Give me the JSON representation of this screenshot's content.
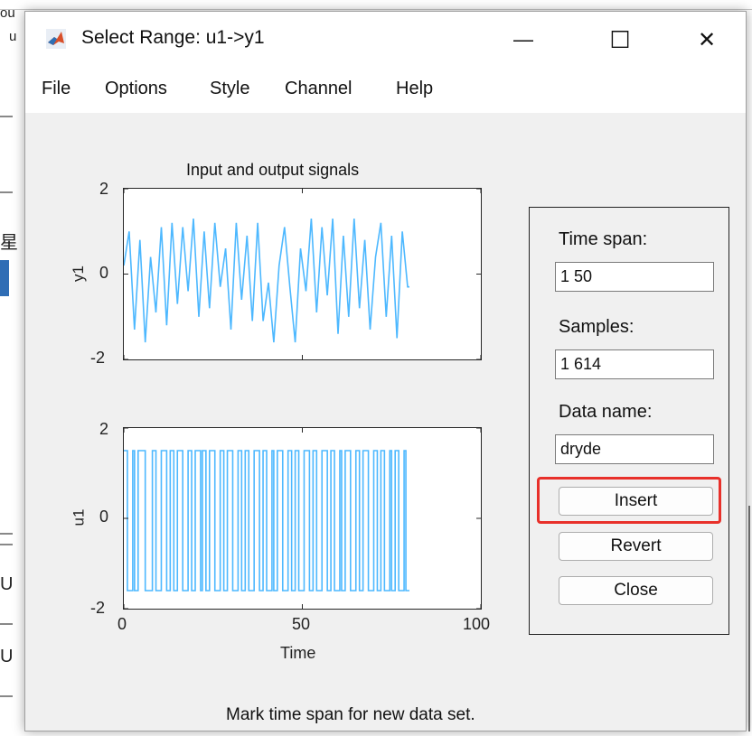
{
  "window": {
    "title": "Select Range: u1->y1",
    "icon": "matlab-icon",
    "minimize_glyph": "—",
    "maximize_glyph": "☐",
    "close_glyph": "✕"
  },
  "menu": [
    "File",
    "Options",
    "Style",
    "Channel",
    "Help"
  ],
  "background": {
    "fragments": [
      "ou",
      "u",
      "星",
      "U",
      "U"
    ]
  },
  "chart_data": [
    {
      "type": "line",
      "title": "Input and output signals",
      "ylabel": "y1",
      "xlabel": "",
      "xlim": [
        0,
        100
      ],
      "ylim": [
        -2,
        2
      ],
      "ytick_labels": [
        "2",
        "0",
        "-2"
      ],
      "series": [
        {
          "color": "#4db8ff",
          "x": [
            0,
            1.5,
            3,
            4.5,
            6,
            7.5,
            9,
            10.5,
            12,
            13.5,
            15,
            16.5,
            18,
            19.5,
            21,
            22.5,
            24,
            25.5,
            27,
            28.5,
            30,
            31.5,
            33,
            34.5,
            36,
            37.5,
            39,
            40.5,
            42,
            43.5,
            45,
            46.5,
            48,
            49.5,
            51,
            52.5,
            54,
            55.5,
            57,
            58.5,
            60,
            61.5,
            63,
            64.5,
            66,
            67.5,
            69,
            70.5,
            72,
            73.5,
            75,
            76.5,
            78,
            79.5,
            80
          ],
          "y": [
            0.2,
            1.0,
            -1.3,
            0.8,
            -1.6,
            0.4,
            -0.9,
            1.1,
            -1.2,
            1.2,
            -0.7,
            1.1,
            -0.4,
            1.3,
            -1.0,
            1.0,
            -0.8,
            1.2,
            -0.3,
            0.6,
            -1.3,
            1.2,
            -0.6,
            0.9,
            -1.1,
            1.2,
            -1.1,
            -0.2,
            -1.6,
            0.2,
            1.1,
            -0.3,
            -1.6,
            0.6,
            -0.4,
            1.3,
            -0.9,
            1.1,
            -0.5,
            1.3,
            -1.4,
            0.9,
            -1.0,
            1.3,
            -0.8,
            0.8,
            -1.3,
            0.4,
            1.2,
            -1.0,
            0.9,
            -1.5,
            1.0,
            -0.3,
            -0.3
          ]
        }
      ]
    },
    {
      "type": "line",
      "title": "",
      "ylabel": "u1",
      "xlabel": "Time",
      "xlim": [
        0,
        100
      ],
      "ylim": [
        -2,
        2
      ],
      "ytick_labels": [
        "2",
        "0",
        "-2"
      ],
      "xtick_labels": [
        "0",
        "50",
        "100"
      ],
      "series": [
        {
          "color": "#4db8ff",
          "levels": [
            1.5,
            -1.6
          ],
          "x_range": [
            0,
            80
          ],
          "switch_times": [
            0,
            1,
            2.5,
            3,
            4,
            6,
            8,
            9,
            10.5,
            12,
            13,
            14,
            15,
            16.5,
            18,
            19,
            20,
            21.5,
            22,
            23,
            24,
            25.5,
            27,
            28,
            29,
            30.5,
            32,
            33,
            34,
            35,
            36.5,
            38,
            39,
            40,
            41.5,
            42,
            43,
            44.5,
            46,
            47,
            48,
            49,
            50.5,
            52,
            53,
            54,
            55.5,
            57,
            58,
            59,
            60.5,
            61,
            62,
            63.5,
            65,
            66,
            67,
            68.5,
            70,
            71,
            72,
            73,
            74.5,
            75,
            76,
            77,
            78.5,
            79,
            80
          ]
        }
      ]
    }
  ],
  "panel": {
    "time_span_label": "Time span:",
    "time_span_value": "1 50",
    "samples_label": "Samples:",
    "samples_value": "1 614",
    "data_name_label": "Data name:",
    "data_name_value": "dryde",
    "insert_label": "Insert",
    "revert_label": "Revert",
    "close_label": "Close"
  },
  "status_text": "Mark time span for new data set."
}
